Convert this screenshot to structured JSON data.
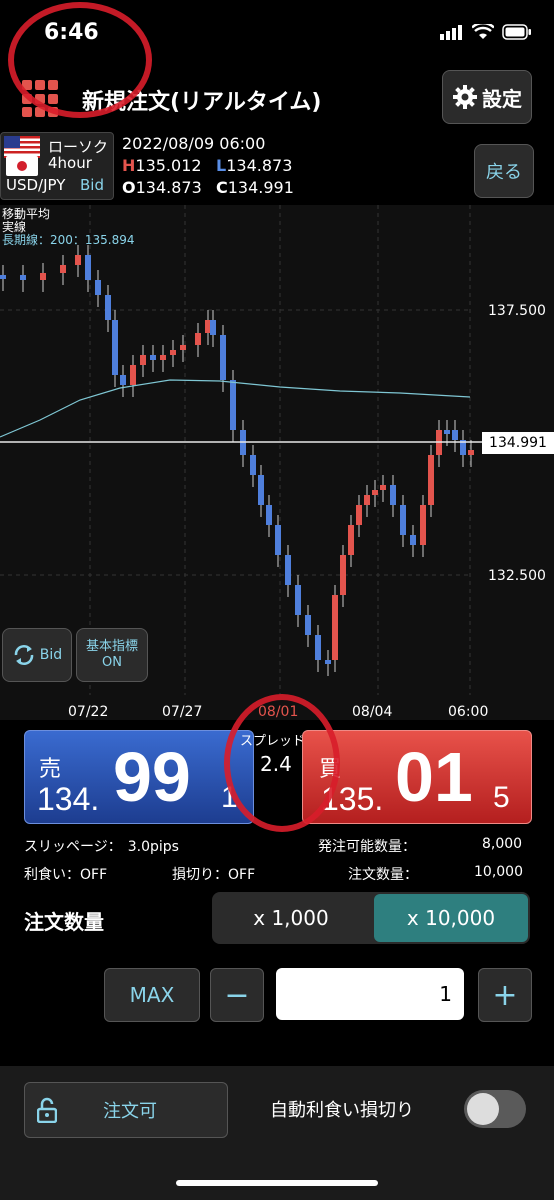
{
  "status": {
    "time": "6:46"
  },
  "header": {
    "title": "新規注文(リアルタイム)",
    "settings_label": "設定"
  },
  "quote_info": {
    "chart_type": "ローソク",
    "interval": "4hour",
    "pair": "USD/JPY",
    "side": "Bid",
    "datetime": "2022/08/09 06:00",
    "high_prefix": "H",
    "high": "135.012",
    "low_prefix": "L",
    "low": "134.873",
    "open_prefix": "O",
    "open": "134.873",
    "close_prefix": "C",
    "close": "134.991"
  },
  "back_label": "戻る",
  "chart": {
    "ma_title": "移動平均",
    "ma_line": "実線",
    "ma_long": "長期線：200：135.894",
    "y_ticks": [
      "137.500",
      "132.500"
    ],
    "current_price": "134.991",
    "x_ticks": [
      "07/22",
      "07/27",
      "08/01",
      "08/04",
      "06:00"
    ],
    "bid_button": "Bid",
    "indicator_button_line1": "基本指標",
    "indicator_button_line2": "ON"
  },
  "trade": {
    "sell_label": "売",
    "sell_prefix": "134.",
    "sell_big": "99",
    "sell_suffix": "1",
    "buy_label": "買",
    "buy_prefix": "135.",
    "buy_big": "01",
    "buy_suffix": "5",
    "spread_label": "スプレッド",
    "spread_value": "2.4"
  },
  "info": {
    "slippage_label": "スリッページ：",
    "slippage_value": "3.0pips",
    "available_label": "発注可能数量：",
    "available_value": "8,000",
    "takeprofit_label": "利食い：OFF",
    "stoploss_label": "損切り：OFF",
    "order_qty_label": "注文数量：",
    "order_qty_value": "10,000"
  },
  "qty": {
    "label": "注文数量",
    "opt1": "x 1,000",
    "opt2": "x 10,000",
    "max": "MAX",
    "minus": "−",
    "value": "1",
    "plus": "+"
  },
  "bottom": {
    "order_button": "注文可",
    "auto_label": "自動利食い損切り"
  },
  "colors": {
    "sell": "#2f5bbf",
    "buy": "#d8322c",
    "accent": "#8ad4ea",
    "active_seg": "#2e7f7f"
  }
}
